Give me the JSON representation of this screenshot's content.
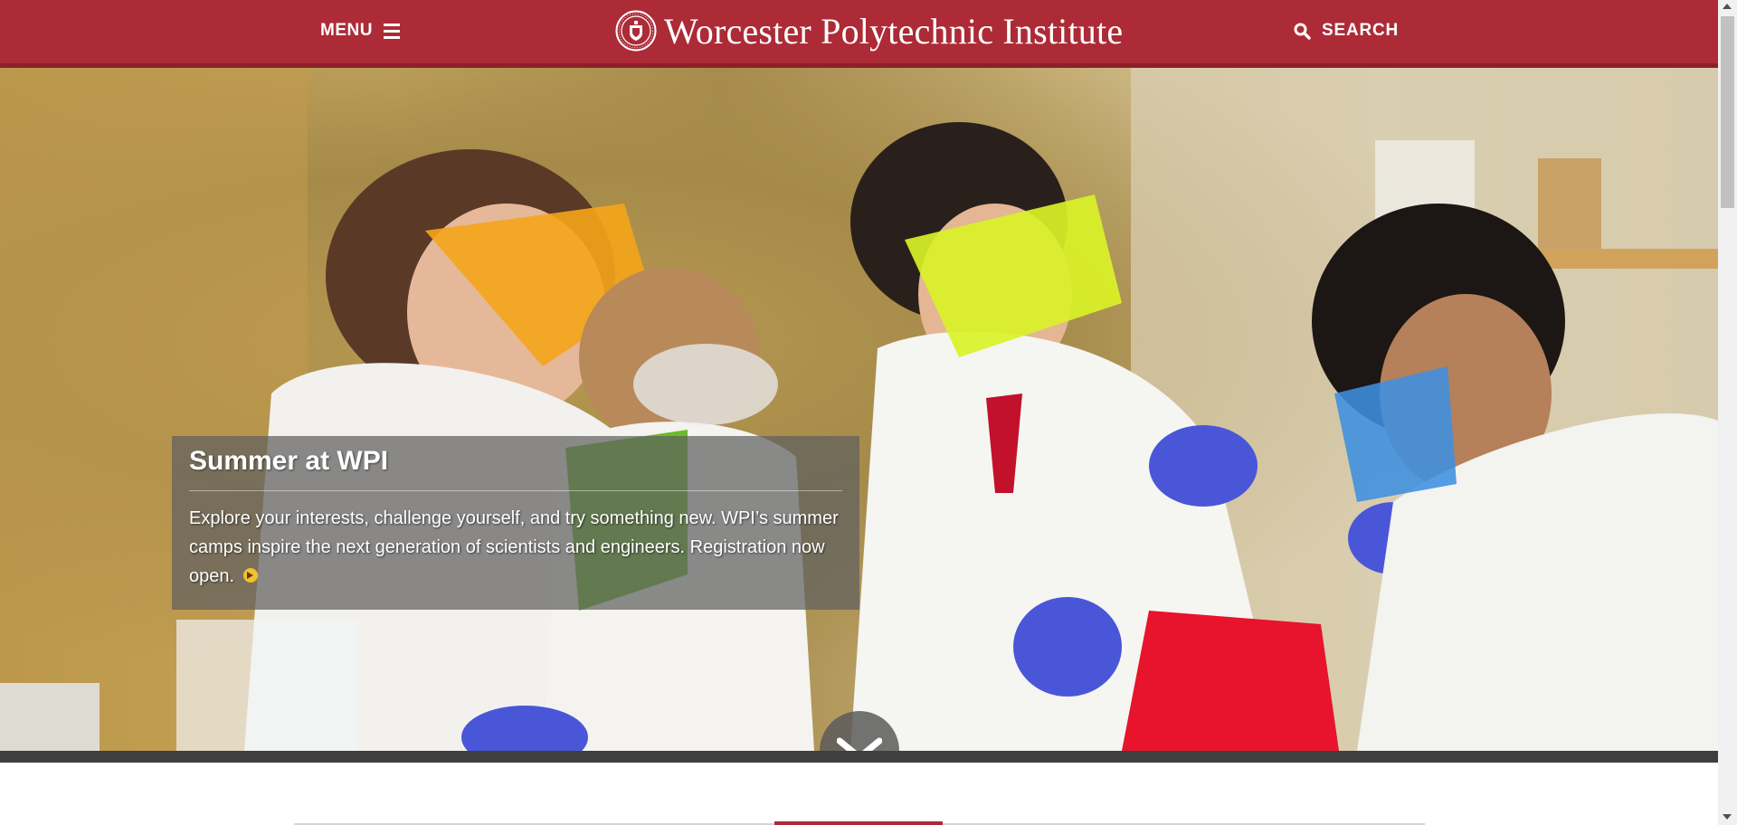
{
  "header": {
    "menu_label": "MENU",
    "brand_name": "Worcester Polytechnic Institute",
    "search_label": "SEARCH",
    "brand_color": "#ac2b37"
  },
  "hero": {
    "caption_title": "Summer at WPI",
    "caption_text": "Explore your interests, challenge yourself, and try something new. WPI’s summer camps inspire the next generation of scientists and engineers. Registration now open.",
    "scroll_icon": "chevron-down-icon"
  },
  "icons": {
    "menu": "hamburger-icon",
    "logo": "seal-icon",
    "search": "search-icon",
    "more": "arrow-right-circle-icon"
  }
}
